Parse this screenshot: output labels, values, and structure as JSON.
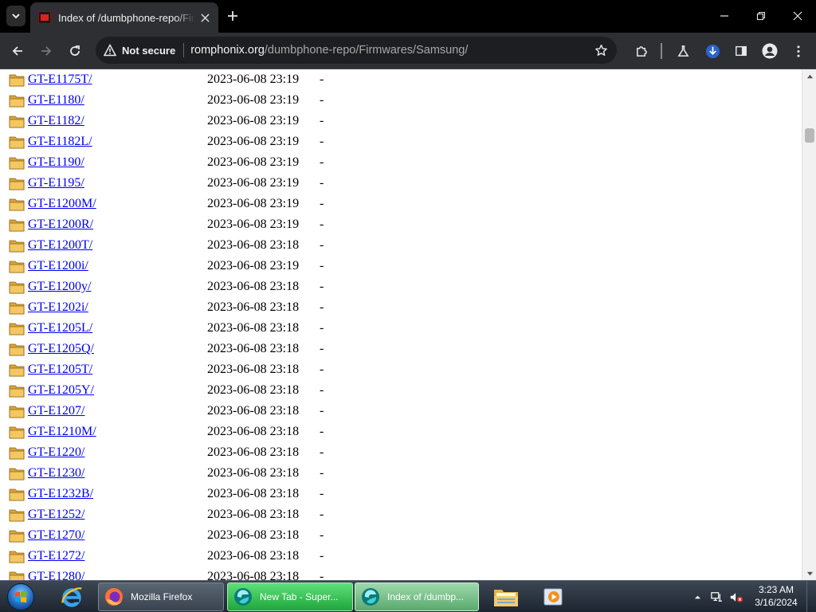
{
  "window": {
    "tab_title": "Index of /dumbphone-repo/Firmwares/Samsung/",
    "url_security_label": "Not secure",
    "url_domain": "romphonix.org",
    "url_path": "/dumbphone-repo/Firmwares/Samsung/"
  },
  "listing": {
    "rows": [
      {
        "name": "GT-E1175T/",
        "date": "2023-06-08 23:19",
        "size": "-"
      },
      {
        "name": "GT-E1180/",
        "date": "2023-06-08 23:19",
        "size": "-"
      },
      {
        "name": "GT-E1182/",
        "date": "2023-06-08 23:19",
        "size": "-"
      },
      {
        "name": "GT-E1182L/",
        "date": "2023-06-08 23:19",
        "size": "-"
      },
      {
        "name": "GT-E1190/",
        "date": "2023-06-08 23:19",
        "size": "-"
      },
      {
        "name": "GT-E1195/",
        "date": "2023-06-08 23:19",
        "size": "-"
      },
      {
        "name": "GT-E1200M/",
        "date": "2023-06-08 23:19",
        "size": "-"
      },
      {
        "name": "GT-E1200R/",
        "date": "2023-06-08 23:19",
        "size": "-"
      },
      {
        "name": "GT-E1200T/",
        "date": "2023-06-08 23:18",
        "size": "-"
      },
      {
        "name": "GT-E1200i/",
        "date": "2023-06-08 23:19",
        "size": "-"
      },
      {
        "name": "GT-E1200y/",
        "date": "2023-06-08 23:18",
        "size": "-"
      },
      {
        "name": "GT-E1202i/",
        "date": "2023-06-08 23:18",
        "size": "-"
      },
      {
        "name": "GT-E1205L/",
        "date": "2023-06-08 23:18",
        "size": "-"
      },
      {
        "name": "GT-E1205Q/",
        "date": "2023-06-08 23:18",
        "size": "-"
      },
      {
        "name": "GT-E1205T/",
        "date": "2023-06-08 23:18",
        "size": "-"
      },
      {
        "name": "GT-E1205Y/",
        "date": "2023-06-08 23:18",
        "size": "-"
      },
      {
        "name": "GT-E1207/",
        "date": "2023-06-08 23:18",
        "size": "-"
      },
      {
        "name": "GT-E1210M/",
        "date": "2023-06-08 23:18",
        "size": "-"
      },
      {
        "name": "GT-E1220/",
        "date": "2023-06-08 23:18",
        "size": "-"
      },
      {
        "name": "GT-E1230/",
        "date": "2023-06-08 23:18",
        "size": "-"
      },
      {
        "name": "GT-E1232B/",
        "date": "2023-06-08 23:18",
        "size": "-"
      },
      {
        "name": "GT-E1252/",
        "date": "2023-06-08 23:18",
        "size": "-"
      },
      {
        "name": "GT-E1270/",
        "date": "2023-06-08 23:18",
        "size": "-"
      },
      {
        "name": "GT-E1272/",
        "date": "2023-06-08 23:18",
        "size": "-"
      },
      {
        "name": "GT-E1280/",
        "date": "2023-06-08 23:18",
        "size": "-"
      }
    ]
  },
  "taskbar": {
    "buttons": [
      {
        "label": "Mozilla Firefox",
        "icon": "firefox-icon"
      },
      {
        "label": "New Tab - Super...",
        "icon": "browser-icon"
      },
      {
        "label": "Index of /dumbp...",
        "icon": "browser-icon"
      }
    ],
    "clock_time": "3:23 AM",
    "clock_date": "3/16/2024"
  },
  "colors": {
    "link": "#0000ee",
    "browser_frame": "#2e2f33",
    "taskbar_active": "#1fa63c"
  }
}
